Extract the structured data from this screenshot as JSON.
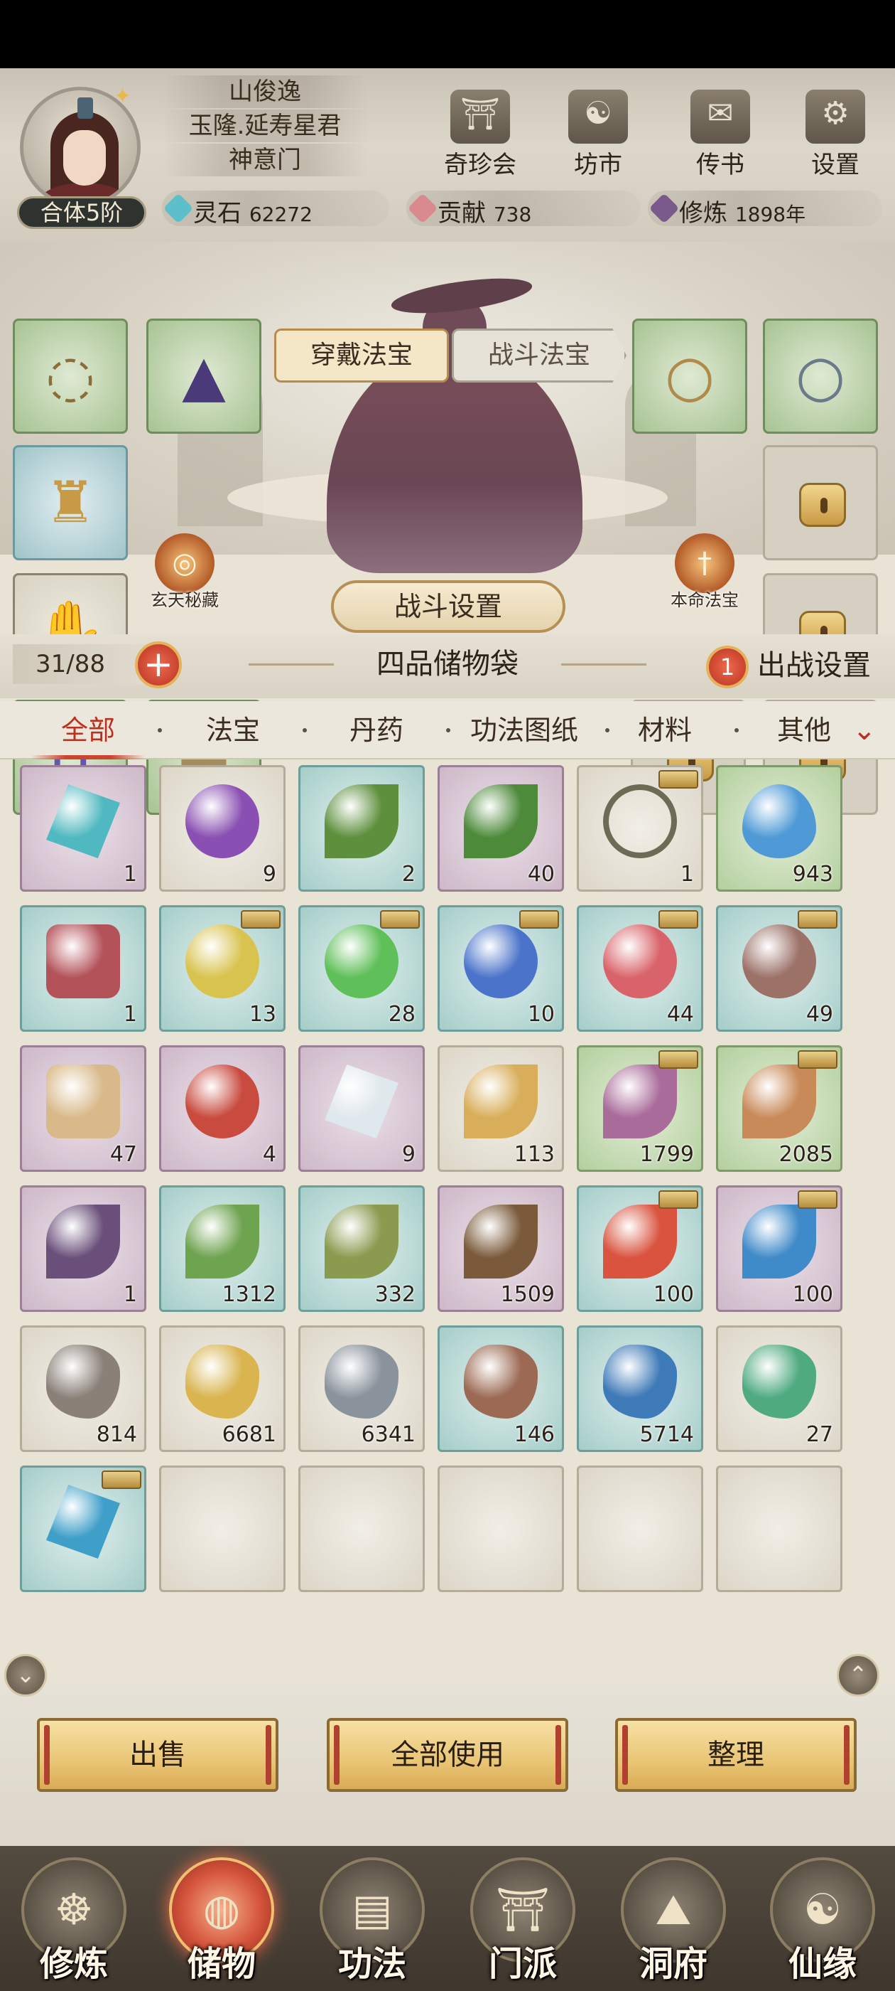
{
  "header": {
    "player_name": "山俊逸",
    "player_title": "玉隆.延寿星君",
    "sect": "神意门",
    "realm": "合体5阶",
    "top_buttons": [
      {
        "label": "奇珍会",
        "icon": "treasure-pavilion-icon"
      },
      {
        "label": "坊市",
        "icon": "market-icon"
      },
      {
        "label": "传书",
        "icon": "scroll-icon"
      },
      {
        "label": "设置",
        "icon": "gear-icon"
      }
    ],
    "resources": {
      "spirit_stone_label": "灵石",
      "spirit_stone_value": "62272",
      "contribution_label": "贡献",
      "contribution_value": "738",
      "cultivation_label": "修炼",
      "cultivation_value": "1898年"
    }
  },
  "equipment": {
    "tab_active": "穿戴法宝",
    "tab_inactive": "战斗法宝",
    "left_badge": "玄天秘藏",
    "right_badge": "本命法宝",
    "battle_settings_button": "战斗设置"
  },
  "bag": {
    "capacity": "31/88",
    "title": "四品储物袋",
    "battle_setup_count": "1",
    "battle_setup_label": "出战设置",
    "categories": [
      "全部",
      "法宝",
      "丹药",
      "功法图纸",
      "材料",
      "其他"
    ],
    "items": [
      {
        "qty": "1",
        "icon": "crystal-shard-icon",
        "color": "#4fb8c0"
      },
      {
        "qty": "9",
        "icon": "purple-orb-icon",
        "color": "#8a4fb2"
      },
      {
        "qty": "2",
        "icon": "herb-icon",
        "color": "#5d8f3c"
      },
      {
        "qty": "40",
        "icon": "herb-icon",
        "color": "#4d8a3a"
      },
      {
        "qty": "1",
        "icon": "necklace-icon",
        "color": "#6e6a55"
      },
      {
        "qty": "943",
        "icon": "water-drop-icon",
        "color": "#4f9ad6"
      },
      {
        "qty": "1",
        "icon": "talisman-icon",
        "color": "#b4525a"
      },
      {
        "qty": "13",
        "icon": "yellow-orb-icon",
        "color": "#d9c34f"
      },
      {
        "qty": "28",
        "icon": "green-orb-icon",
        "color": "#5fbf58"
      },
      {
        "qty": "10",
        "icon": "blue-orb-icon",
        "color": "#4a73c9"
      },
      {
        "qty": "44",
        "icon": "red-orb-icon",
        "color": "#d9636a"
      },
      {
        "qty": "49",
        "icon": "brown-orb-icon",
        "color": "#9c7168"
      },
      {
        "qty": "47",
        "icon": "wood-token-icon",
        "color": "#d9b98a"
      },
      {
        "qty": "4",
        "icon": "fire-orb-icon",
        "color": "#c94a3f"
      },
      {
        "qty": "9",
        "icon": "white-crystal-icon",
        "color": "#dfe8ec"
      },
      {
        "qty": "113",
        "icon": "ginseng-icon",
        "color": "#d9ae5a"
      },
      {
        "qty": "1799",
        "icon": "purple-flower-icon",
        "color": "#a96b9a"
      },
      {
        "qty": "2085",
        "icon": "root-icon",
        "color": "#c98a5a"
      },
      {
        "qty": "1",
        "icon": "berry-branch-icon",
        "color": "#6a4f7a"
      },
      {
        "qty": "1312",
        "icon": "white-flower-icon",
        "color": "#6ea34f"
      },
      {
        "qty": "332",
        "icon": "red-bud-plant-icon",
        "color": "#8a9a4f"
      },
      {
        "qty": "1509",
        "icon": "fruit-branch-icon",
        "color": "#7a5a3a"
      },
      {
        "qty": "100",
        "icon": "red-berry-icon",
        "color": "#d9533f"
      },
      {
        "qty": "100",
        "icon": "blue-berry-icon",
        "color": "#3f8ac9"
      },
      {
        "qty": "814",
        "icon": "grey-ore-icon",
        "color": "#8a8078"
      },
      {
        "qty": "6681",
        "icon": "gold-ore-icon",
        "color": "#d9b44f"
      },
      {
        "qty": "6341",
        "icon": "silver-ore-icon",
        "color": "#8a929c"
      },
      {
        "qty": "146",
        "icon": "copper-ore-icon",
        "color": "#9c6a54"
      },
      {
        "qty": "5714",
        "icon": "blue-ore-icon",
        "color": "#3f7ab8"
      },
      {
        "qty": "27",
        "icon": "jade-ore-icon",
        "color": "#4faa80"
      },
      {
        "qty": "",
        "icon": "ice-crystal-icon",
        "color": "#3f9fc9"
      },
      {
        "qty": "",
        "icon": "",
        "color": ""
      },
      {
        "qty": "",
        "icon": "",
        "color": ""
      },
      {
        "qty": "",
        "icon": "",
        "color": ""
      },
      {
        "qty": "",
        "icon": "",
        "color": ""
      },
      {
        "qty": "",
        "icon": "",
        "color": ""
      }
    ]
  },
  "actions": {
    "sell": "出售",
    "use_all": "全部使用",
    "sort": "整理"
  },
  "nav": [
    {
      "label": "修炼",
      "icon": "cultivation-icon"
    },
    {
      "label": "储物",
      "icon": "storage-bag-icon"
    },
    {
      "label": "功法",
      "icon": "technique-scroll-icon"
    },
    {
      "label": "门派",
      "icon": "sect-gate-icon"
    },
    {
      "label": "洞府",
      "icon": "cave-residence-icon"
    },
    {
      "label": "仙缘",
      "icon": "immortal-fate-icon"
    }
  ]
}
